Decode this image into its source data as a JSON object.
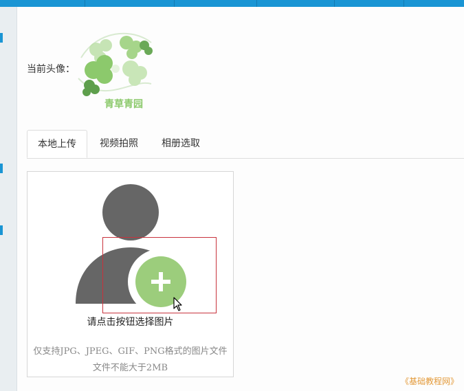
{
  "profile": {
    "current_avatar_label": "当前头像：",
    "avatar_text": "青草青园"
  },
  "tabs": [
    {
      "label": "本地上传",
      "active": true
    },
    {
      "label": "视频拍照",
      "active": false
    },
    {
      "label": "相册选取",
      "active": false
    }
  ],
  "upload": {
    "prompt": "请点击按钮选择图片",
    "formats_note": "仅支持JPG、JPEG、GIF、PNG格式的图片文件",
    "size_note": "文件不能大于2MB"
  },
  "watermark": "《基础教程网》",
  "colors": {
    "topbar": "#1a95d4",
    "person": "#666666",
    "plus_circle": "#9ccd7c",
    "selection": "#c8323c",
    "watermark": "#e39a3a"
  }
}
